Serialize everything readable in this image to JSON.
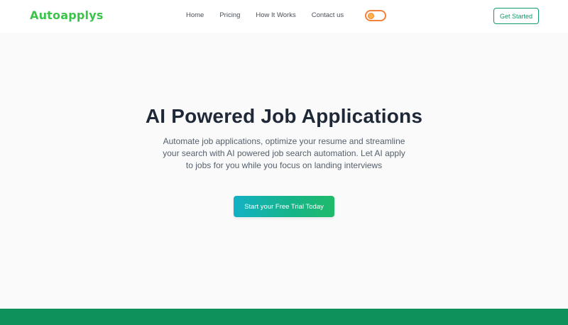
{
  "brand": {
    "name": "Autoapplys",
    "logo_color": "#3cc34a"
  },
  "nav": {
    "links": [
      "Home",
      "Pricing",
      "How It Works",
      "Contact us"
    ],
    "get_started_label": "Get Started"
  },
  "theme_toggle": {
    "icon": "sun-icon",
    "accent": "#f2813a"
  },
  "hero": {
    "title": "AI Powered Job Applications",
    "subtitle": "Automate job applications, optimize your resume and streamline your search with AI powered job search automation. Let AI apply to jobs for you while you focus on landing interviews",
    "cta_label": "Start your Free Trial Today"
  },
  "colors": {
    "primary_green": "#0f915b",
    "cta_start": "#12b1c4",
    "cta_end": "#1fba6a"
  }
}
